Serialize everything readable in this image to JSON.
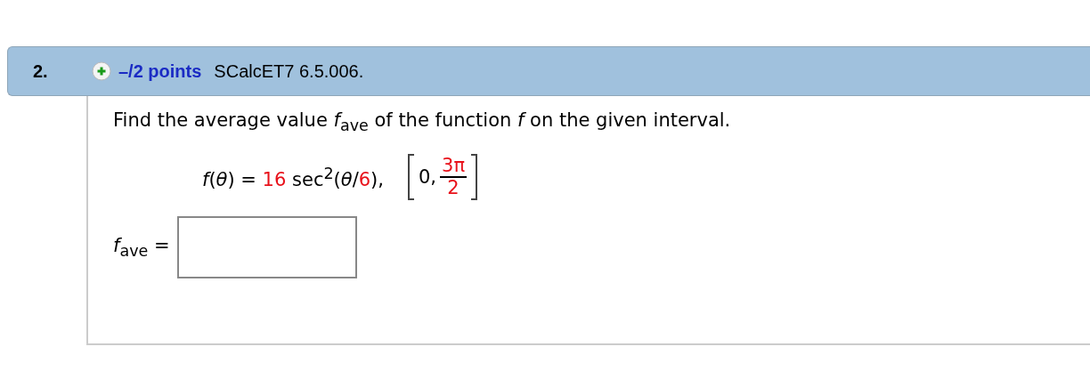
{
  "question": {
    "number": "2.",
    "points": "–/2 points",
    "source": "SCalcET7 6.5.006."
  },
  "prompt": "Find the average value *f*$_{ave}$ of the function *f* on the given interval.",
  "formula": [
    {
      "text": "*f*(*θ*) = ",
      "kind": "plain"
    },
    {
      "text": "16",
      "kind": "given"
    },
    {
      "text": " sec$^{2}$(*θ*/",
      "kind": "plain"
    },
    {
      "text": "6",
      "kind": "given"
    },
    {
      "text": "),",
      "kind": "plain"
    }
  ],
  "interval": {
    "lower": "0,",
    "upper_numerator": "3π",
    "upper_denominator": "2"
  },
  "answer": {
    "label": "*f*$_{ave}$ ="
  }
}
